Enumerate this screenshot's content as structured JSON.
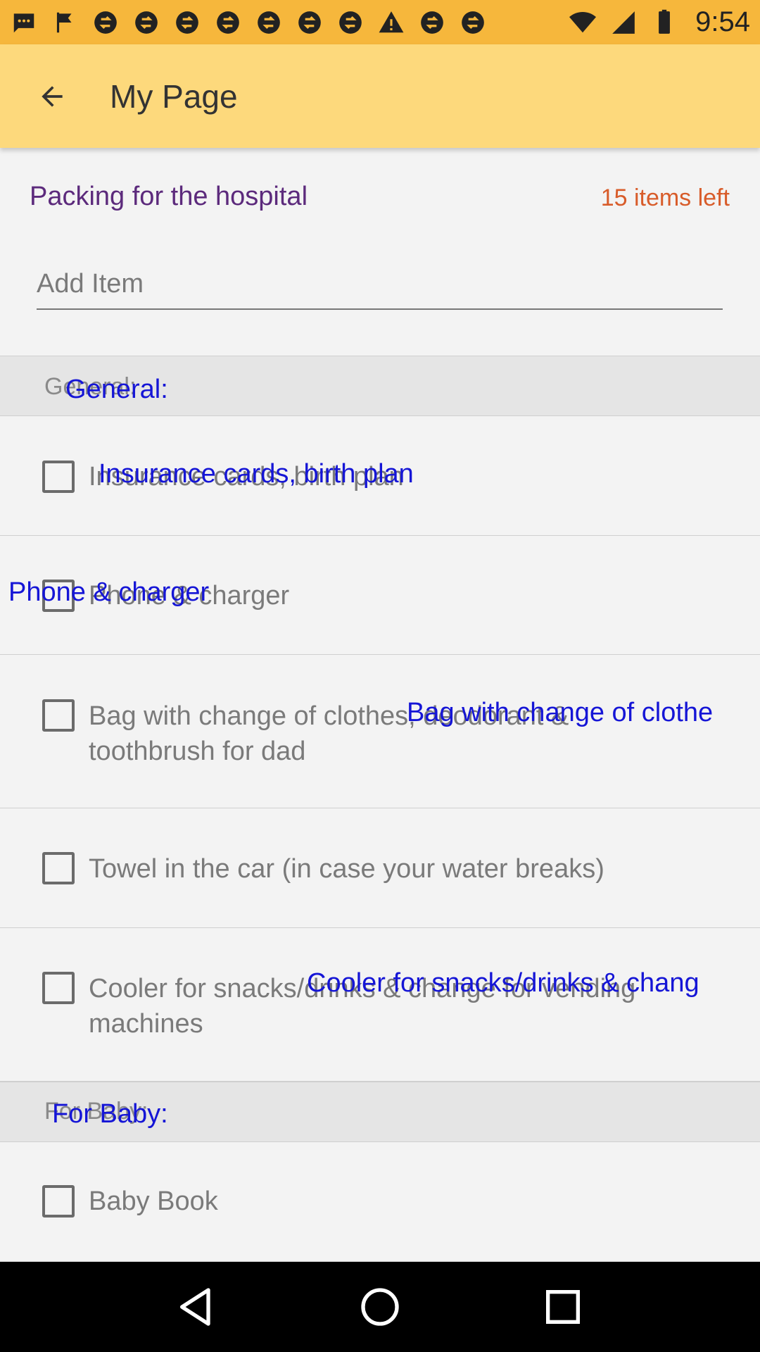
{
  "status_bar": {
    "time": "9:54",
    "icons": [
      "message-icon",
      "flag-icon",
      "sync-icon",
      "sync-icon",
      "sync-icon",
      "sync-icon",
      "sync-icon",
      "sync-icon",
      "sync-icon",
      "warning-icon",
      "sync-icon",
      "sync-icon"
    ],
    "right_icons": [
      "wifi-icon",
      "signal-icon",
      "battery-icon"
    ]
  },
  "app_bar": {
    "title": "My Page",
    "back_icon": "arrow-back-icon"
  },
  "list": {
    "title": "Packing for the hospital",
    "items_left": "15 items left",
    "add_item_placeholder": "Add Item"
  },
  "sections": [
    {
      "label": "General:",
      "overlay": "General:",
      "items": [
        {
          "text": "Insurance cards, birth plan",
          "overlay": "Insurance cards, birth plan",
          "checked": false
        },
        {
          "text": "Phone & charger",
          "overlay": "Phone & charger",
          "checked": false
        },
        {
          "text": "Bag with change of clothes, deodorant & toothbrush for dad",
          "overlay": "Bag with change of clothe",
          "checked": false
        },
        {
          "text": "Towel in the car (in case your water breaks)",
          "checked": false
        },
        {
          "text": "Cooler for snacks/drinks & change for vending machines",
          "overlay": "Cooler for snacks/drinks & chang",
          "checked": false
        }
      ]
    },
    {
      "label": "For Baby:",
      "overlay": "For Baby:",
      "items": [
        {
          "text": "Baby Book",
          "checked": false
        }
      ]
    }
  ],
  "colors": {
    "status_bar": "#f6b73c",
    "app_bar": "#fdd97c",
    "list_title": "#5c2a7c",
    "items_left": "#d85c2a",
    "overlay_text": "#1515d6"
  },
  "nav_bar": [
    "back-triangle-icon",
    "home-circle-icon",
    "recents-square-icon"
  ]
}
